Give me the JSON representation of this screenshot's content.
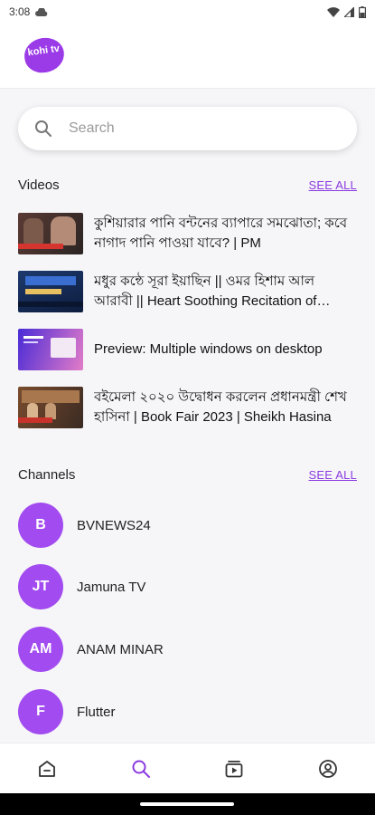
{
  "status_bar": {
    "time": "3:08"
  },
  "app": {
    "logo_text": "kohi tv",
    "brand_color": "#9b3be8"
  },
  "search": {
    "placeholder": "Search"
  },
  "videos": {
    "title": "Videos",
    "see_all": "SEE ALL",
    "items": [
      {
        "title": "কুশিয়ারার পানি বন্টনের ব্যাপারে সমঝোতা; কবে নাগাদ পানি পাওয়া যাবে? | PM",
        "thumb_colors": [
          "#5a3a34",
          "#2b2523"
        ],
        "thumb_accent": "#d6352f"
      },
      {
        "title": "মধুর কন্ঠে সূরা ইয়াছিন || ওমর হিশাম আল আরাবী || Heart Soothing Recitation of Surah Yasin",
        "thumb_colors": [
          "#1d3a6e",
          "#0d1c3d"
        ],
        "thumb_accent": "#3a6fd1"
      },
      {
        "title": "Preview: Multiple windows on desktop",
        "thumb_colors": [
          "#4a2bd6",
          "#e27cc8"
        ],
        "thumb_accent": "#ffffff"
      },
      {
        "title": "বইমেলা ২০২০ উদ্বোধন করলেন প্রধানমন্ত্রী শেখ হাসিনা | Book Fair 2023 | Sheikh Hasina",
        "thumb_colors": [
          "#7a4c2e",
          "#3a2a22"
        ],
        "thumb_accent": "#c8322a"
      }
    ]
  },
  "channels": {
    "title": "Channels",
    "see_all": "SEE ALL",
    "items": [
      {
        "initials": "B",
        "name": "BVNEWS24"
      },
      {
        "initials": "JT",
        "name": "Jamuna TV"
      },
      {
        "initials": "AM",
        "name": "ANAM MINAR"
      },
      {
        "initials": "F",
        "name": "Flutter"
      }
    ]
  },
  "bottom_nav": [
    {
      "icon": "home-icon",
      "active": false
    },
    {
      "icon": "search-icon",
      "active": true
    },
    {
      "icon": "library-icon",
      "active": false
    },
    {
      "icon": "profile-icon",
      "active": false
    }
  ],
  "colors": {
    "accent": "#8b3be0",
    "avatar": "#a24bf0",
    "icon_inactive": "#333333"
  }
}
